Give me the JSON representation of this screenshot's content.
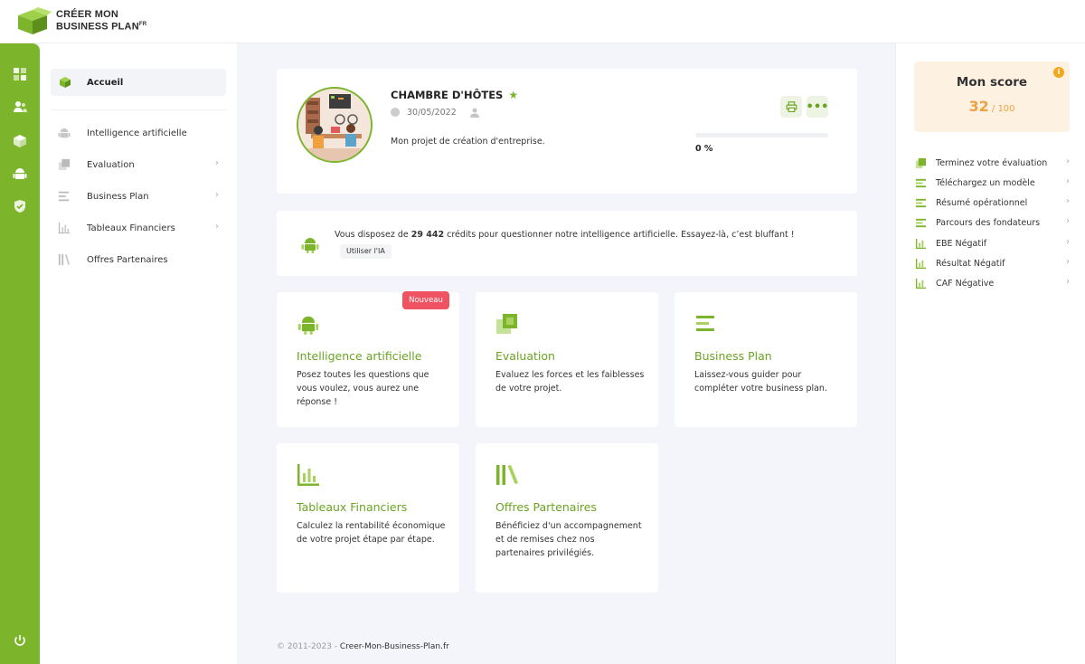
{
  "brand": {
    "line1": "CRÉER MON",
    "line2": "BUSINESS PLAN",
    "suffix": "FR",
    "green": "#7cb42b"
  },
  "rail": {
    "icons": [
      "dashboard-icon",
      "users-icon",
      "cube-icon",
      "android-icon",
      "shield-check-icon",
      "power-icon"
    ]
  },
  "sidebar": {
    "home": "Accueil",
    "items": [
      {
        "label": "Intelligence artificielle",
        "icon": "android-icon",
        "chevron": false
      },
      {
        "label": "Evaluation",
        "icon": "layers-icon",
        "chevron": true
      },
      {
        "label": "Business Plan",
        "icon": "lines-icon",
        "chevron": true
      },
      {
        "label": "Tableaux Financiers",
        "icon": "bar-chart-icon",
        "chevron": true
      },
      {
        "label": "Offres Partenaires",
        "icon": "books-icon",
        "chevron": false
      }
    ]
  },
  "project": {
    "title": "CHAMBRE D'HÔTES",
    "date": "30/05/2022",
    "description": "Mon projet de création d'entreprise.",
    "progress": 0,
    "progress_label": "0 %"
  },
  "credits": {
    "prefix": "Vous disposez de ",
    "amount": "29 442",
    "suffix": " crédits pour questionner notre intelligence artificielle. Essayez-là, c’est bluffant !",
    "button": "Utiliser l'IA"
  },
  "features": [
    {
      "title": "Intelligence artificielle",
      "desc": "Posez toutes les questions que vous voulez, vous aurez une réponse !",
      "badge": "Nouveau"
    },
    {
      "title": "Evaluation",
      "desc": "Evaluez les forces et les faiblesses de votre projet."
    },
    {
      "title": "Business Plan",
      "desc": "Laissez-vous guider pour compléter votre business plan."
    },
    {
      "title": "Tableaux Financiers",
      "desc": "Calculez la rentabilité économique de votre projet étape par étape."
    },
    {
      "title": "Offres Partenaires",
      "desc": "Bénéficiez d'un accompagnement et de remises chez nos partenaires privilégiés."
    }
  ],
  "footer": {
    "copyright": "© 2011-2023 - ",
    "site": "Creer-Mon-Business-Plan.fr"
  },
  "score": {
    "title": "Mon score",
    "value": "32",
    "max": " / 100",
    "info": "i",
    "items": [
      "Terminez votre évaluation",
      "Téléchargez un modèle",
      "Résumé opérationnel",
      "Parcours des fondateurs",
      "EBE Négatif",
      "Résultat Négatif",
      "CAF Négative"
    ]
  }
}
